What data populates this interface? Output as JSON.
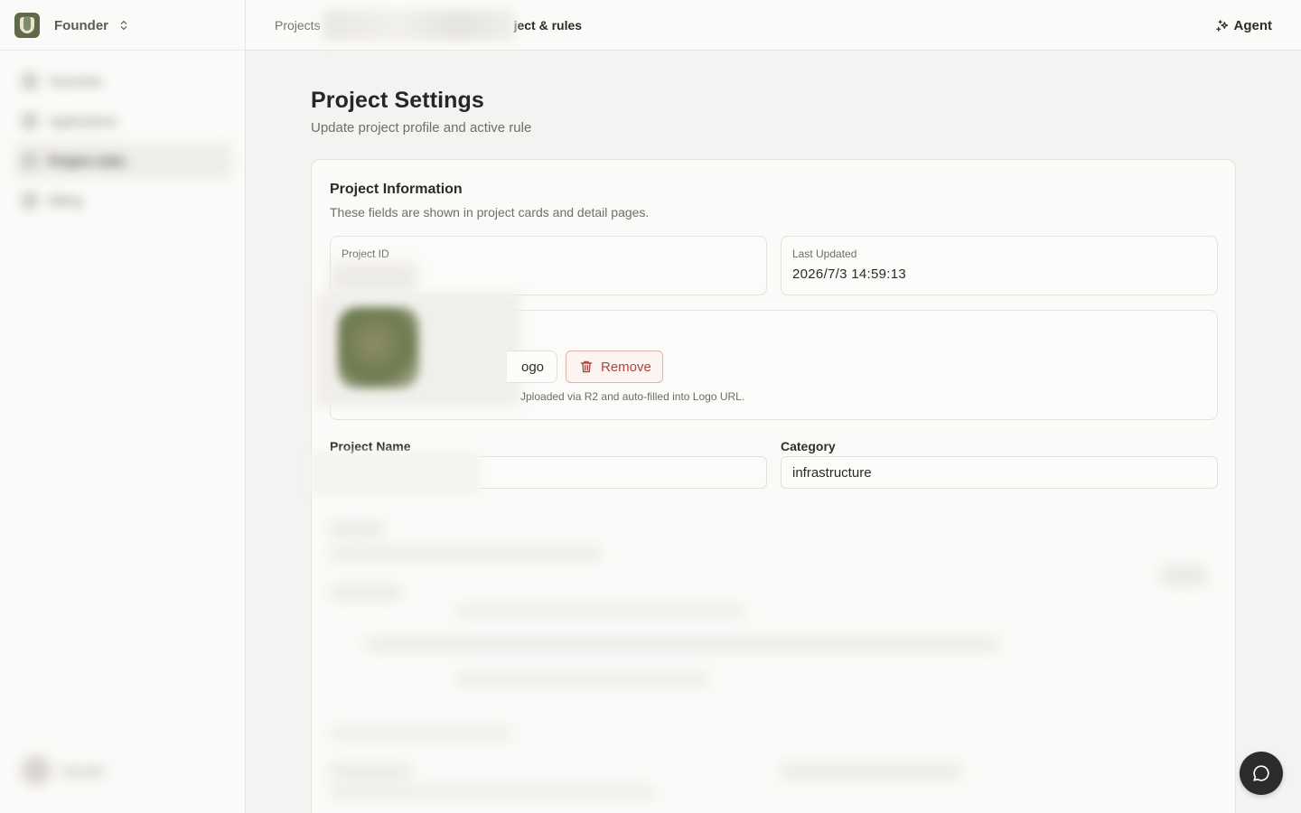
{
  "sidebar": {
    "workspace_name": "Founder",
    "workspace_logo_icon": "project-logo-icon",
    "switcher_icon": "chevron-up-down-icon",
    "nav_items": [
      {
        "label": "Overview",
        "icon": "home-icon"
      },
      {
        "label": "Applications",
        "icon": "apps-icon"
      },
      {
        "label": "Project rules",
        "icon": "rules-icon",
        "active": true
      },
      {
        "label": "Billing",
        "icon": "billing-icon"
      }
    ],
    "footer_user": "Account"
  },
  "topbar": {
    "breadcrumb_root": "Projects",
    "breadcrumb_current": "ject & rules",
    "agent_label": "Agent",
    "agent_icon": "sparkle-icon"
  },
  "page": {
    "title": "Project Settings",
    "subtitle": "Update project profile and active rule"
  },
  "project_info": {
    "title": "Project Information",
    "subtitle": "These fields are shown in project cards and detail pages.",
    "project_id_label": "Project ID",
    "last_updated_label": "Last Updated",
    "last_updated_value": "2026/7/3 14:59:13",
    "upload_label": "ogo",
    "remove_label": "Remove",
    "remove_icon": "trash-icon",
    "logo_hint": "Jploaded via R2 and auto-filled into Logo URL.",
    "project_name_label": "Project Name",
    "category_label": "Category",
    "category_value": "infrastructure"
  },
  "chat": {
    "icon": "chat-bubble-icon"
  },
  "colors": {
    "background": "#f4f3f1",
    "surface": "#fbfaf8",
    "danger": "#a94a3b",
    "fab": "#2b2d2a"
  }
}
